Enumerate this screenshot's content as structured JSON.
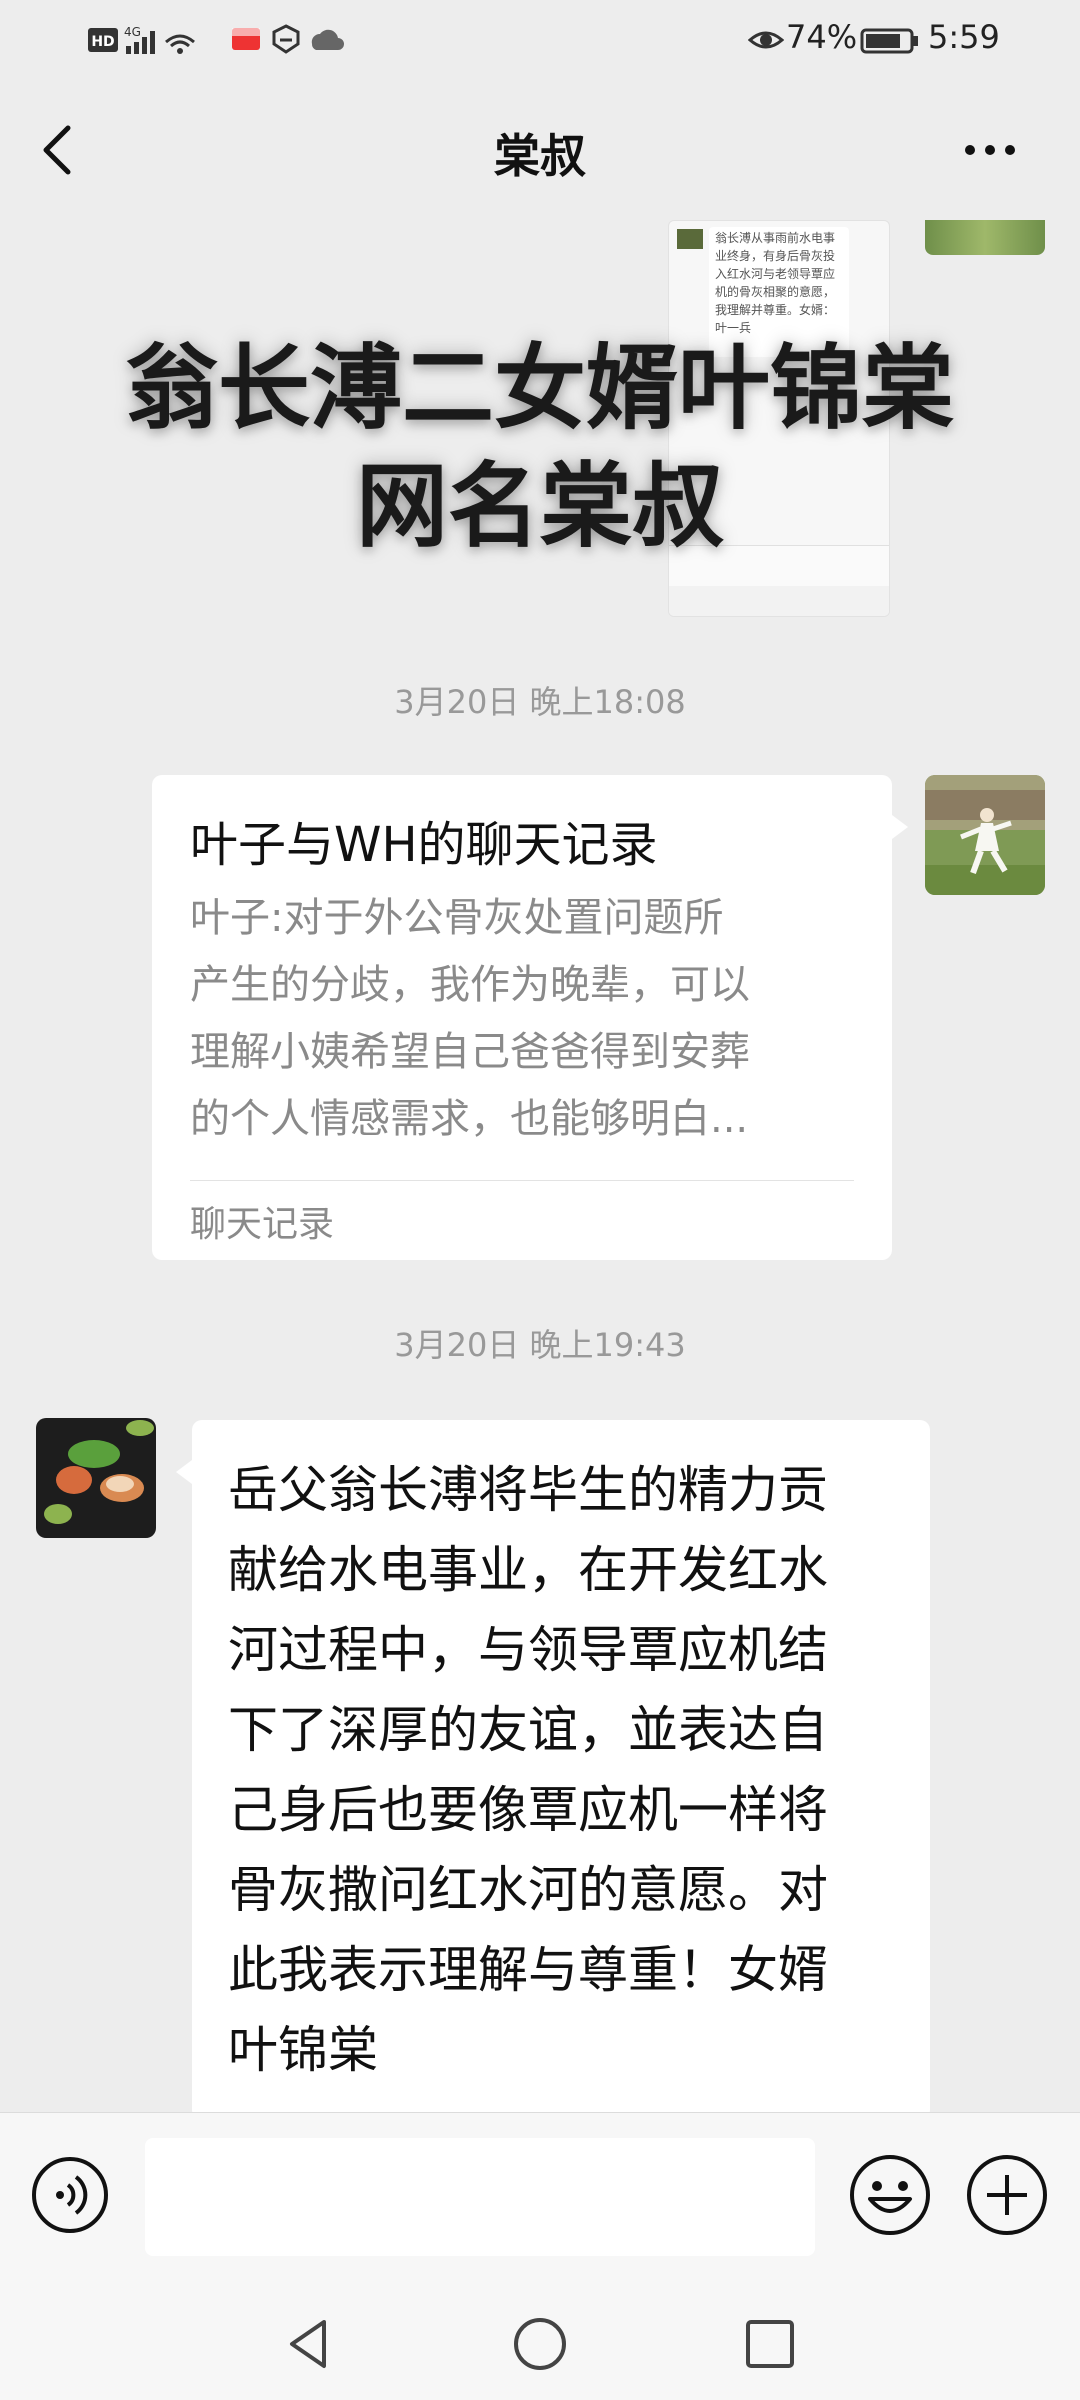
{
  "status_bar": {
    "network_badges": "HD 4G",
    "battery_percent": "74%",
    "time": "5:59"
  },
  "header": {
    "title": "棠叔",
    "back_icon": "chevron-left-icon",
    "more_icon": "more-dots-icon"
  },
  "overlay_caption": {
    "line1": "翁长溥二女婿叶锦棠",
    "line2": "网名棠叔"
  },
  "shared_image": {
    "visible_text": "翁长溥从事雨前水电事业终身，有身后骨灰投入红水河与老领导覃应机的骨灰相聚的意愿，我理解并尊重。女婿：叶一兵"
  },
  "messages": [
    {
      "timestamp": "3月20日 晚上18:08",
      "type": "chat_record",
      "sender": "me",
      "title": "叶子与WH的聊天记录",
      "preview_lines": [
        "叶子:对于外公骨灰处置问题所",
        "产生的分歧，我作为晚辈，可以",
        "理解小姨希望自己爸爸得到安葬",
        "的个人情感需求，也能够明白..."
      ],
      "footer": "聊天记录"
    },
    {
      "timestamp": "3月20日 晚上19:43",
      "type": "text",
      "sender": "other",
      "lines": [
        "岳父翁长溥将毕生的精力贡",
        "献给水电事业，在开发红水",
        "河过程中，与领导覃应机结",
        "下了深厚的友谊，並表达自",
        "己身后也要像覃应机一样将",
        "骨灰撒问红水河的意愿。对",
        "此我表示理解与尊重！女婿",
        "叶锦棠"
      ]
    }
  ],
  "input_bar": {
    "voice_icon": "voice-icon",
    "input_value": "",
    "emoji_icon": "emoji-icon",
    "plus_icon": "plus-icon"
  },
  "nav_bar": {
    "back_icon": "nav-back-icon",
    "home_icon": "nav-home-icon",
    "recents_icon": "nav-recents-icon"
  }
}
